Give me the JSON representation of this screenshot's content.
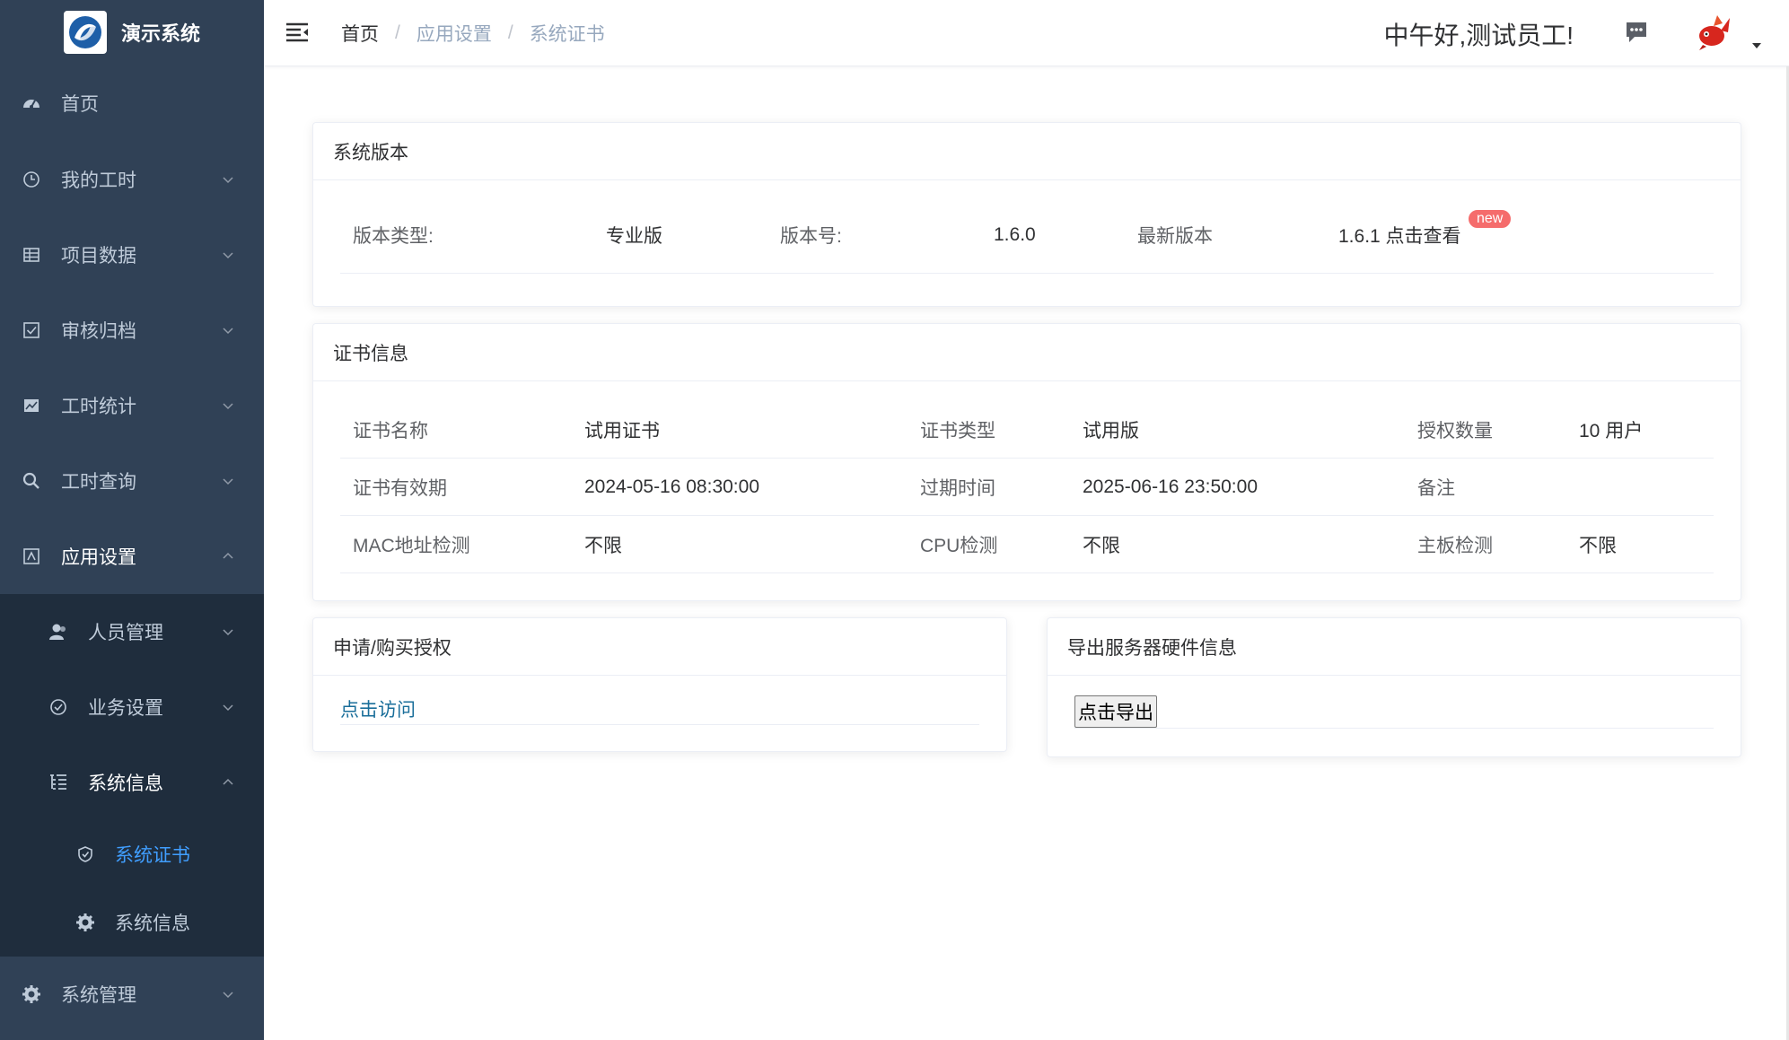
{
  "app": {
    "title": "演示系统"
  },
  "sidebar": {
    "items": [
      {
        "label": "首页"
      },
      {
        "label": "我的工时"
      },
      {
        "label": "项目数据"
      },
      {
        "label": "审核归档"
      },
      {
        "label": "工时统计"
      },
      {
        "label": "工时查询"
      },
      {
        "label": "应用设置"
      },
      {
        "label": "系统管理"
      }
    ],
    "sub": [
      {
        "label": "人员管理"
      },
      {
        "label": "业务设置"
      },
      {
        "label": "系统信息"
      }
    ],
    "sub2": [
      {
        "label": "系统证书"
      },
      {
        "label": "系统信息"
      }
    ]
  },
  "header": {
    "breadcrumb": [
      "首页",
      "应用设置",
      "系统证书"
    ],
    "separator": "/",
    "greeting": "中午好,测试员工!"
  },
  "version_card": {
    "title": "系统版本",
    "type_label": "版本类型:",
    "type_value": "专业版",
    "no_label": "版本号:",
    "no_value": "1.6.0",
    "latest_label": "最新版本",
    "latest_value": "1.6.1 点击查看",
    "badge": "new"
  },
  "cert_card": {
    "title": "证书信息",
    "rows": [
      [
        "证书名称",
        "试用证书",
        "证书类型",
        "试用版",
        "授权数量",
        "10 用户"
      ],
      [
        "证书有效期",
        "2024-05-16 08:30:00",
        "过期时间",
        "2025-06-16 23:50:00",
        "备注",
        ""
      ],
      [
        "MAC地址检测",
        "不限",
        "CPU检测",
        "不限",
        "主板检测",
        "不限"
      ]
    ]
  },
  "apply_card": {
    "title": "申请/购买授权",
    "link": "点击访问"
  },
  "export_card": {
    "title": "导出服务器硬件信息",
    "button": "点击导出"
  },
  "colors": {
    "sidebar_bg": "#304156",
    "submenu_bg": "#1f2d3d",
    "active": "#409eff",
    "badge": "#f56c6c"
  }
}
